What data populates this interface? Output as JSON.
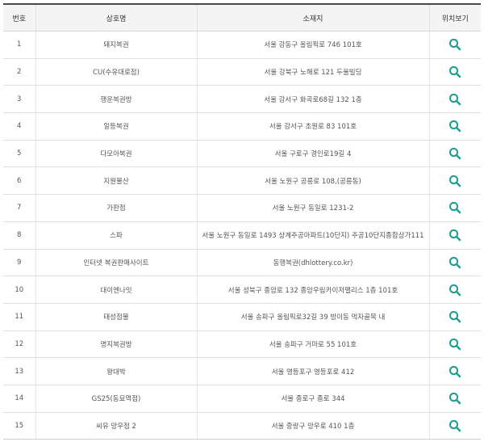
{
  "table": {
    "headers": {
      "number": "번호",
      "name": "상호명",
      "address": "소재지",
      "map": "위치보기"
    },
    "map_icon": "search-icon",
    "accent_color": "#1e9e8e",
    "rows": [
      {
        "no": "1",
        "name": "돼지복권",
        "address": "서울 강동구 올림픽로 746 101호"
      },
      {
        "no": "2",
        "name": "CU(수유대로점)",
        "address": "서울 강북구 노해로 121 두울빌딩"
      },
      {
        "no": "3",
        "name": "행운복권방",
        "address": "서울 강서구 화곡로68길 132 1층"
      },
      {
        "no": "4",
        "name": "일등복권",
        "address": "서울 강서구 초원로 83 101호"
      },
      {
        "no": "5",
        "name": "다모아복권",
        "address": "서울 구로구 경인로19길 4"
      },
      {
        "no": "6",
        "name": "지원물산",
        "address": "서울 노원구 공릉로 108,(공릉동)"
      },
      {
        "no": "7",
        "name": "가판점",
        "address": "서울 노원구 동일로 1231-2"
      },
      {
        "no": "8",
        "name": "스파",
        "address": "서울 노원구 동일로 1493 상계주공아파트(10단지) 주공10단지종합상가111"
      },
      {
        "no": "9",
        "name": "인터넷 복권판매사이트",
        "address": "동행복권(dhlottery.co.kr)"
      },
      {
        "no": "10",
        "name": "대이엔나잇",
        "address": "서울 성북구 종암로 132 종암우림카이저팰리스 1층 101호"
      },
      {
        "no": "11",
        "name": "태성점물",
        "address": "서울 송파구 올림픽로32길 39 방이동 먹자골목 내"
      },
      {
        "no": "12",
        "name": "명지복권방",
        "address": "서울 송파구 거마로 55 101호"
      },
      {
        "no": "13",
        "name": "왕대박",
        "address": "서울 영등포구 영등포로 412"
      },
      {
        "no": "14",
        "name": "GS25(동묘역점)",
        "address": "서울 종로구 종로 344"
      },
      {
        "no": "15",
        "name": "씨유 망우점 2",
        "address": "서울 중랑구 망우로 410 1층"
      }
    ]
  }
}
